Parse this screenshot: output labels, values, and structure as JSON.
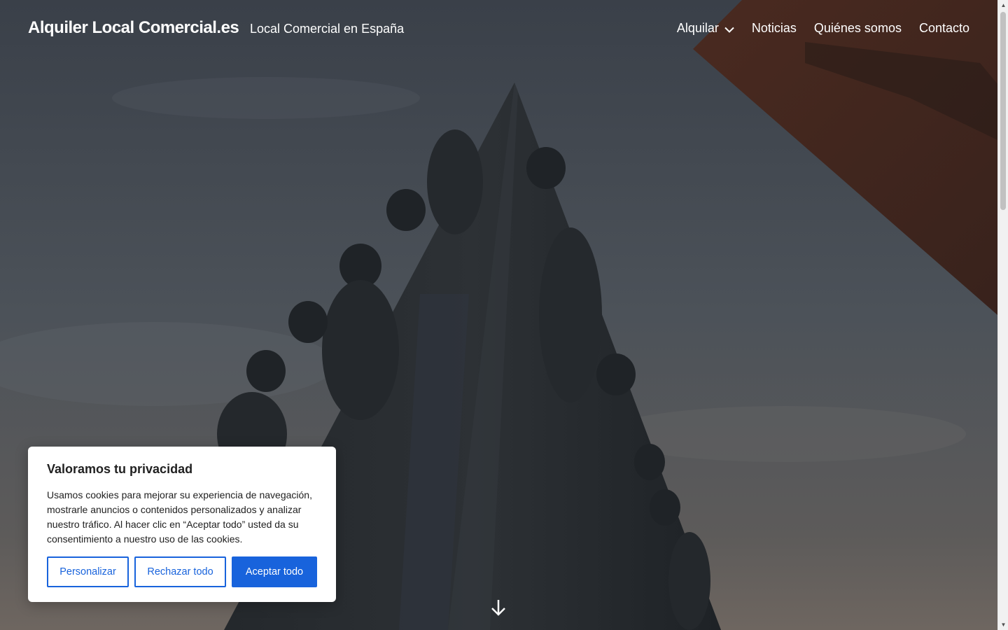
{
  "header": {
    "site_title": "Alquiler Local Comercial.es",
    "tagline": "Local Comercial en España"
  },
  "nav": {
    "items": [
      {
        "label": "Alquilar",
        "has_dropdown": true
      },
      {
        "label": "Noticias"
      },
      {
        "label": "Quiénes somos"
      },
      {
        "label": "Contacto"
      }
    ]
  },
  "cookie_banner": {
    "title": "Valoramos tu privacidad",
    "text": "Usamos cookies para mejorar su experiencia de navegación, mostrarle anuncios o contenidos personalizados y analizar nuestro tráfico. Al hacer clic en “Aceptar todo” usted da su consentimiento a nuestro uso de las cookies.",
    "buttons": {
      "customize": "Personalizar",
      "reject": "Rechazar todo",
      "accept": "Aceptar todo"
    }
  },
  "icons": {
    "dropdown": "chevron-down-icon",
    "scroll": "arrow-down-icon"
  },
  "colors": {
    "accent": "#1863dc",
    "text_on_hero": "#ffffff"
  }
}
